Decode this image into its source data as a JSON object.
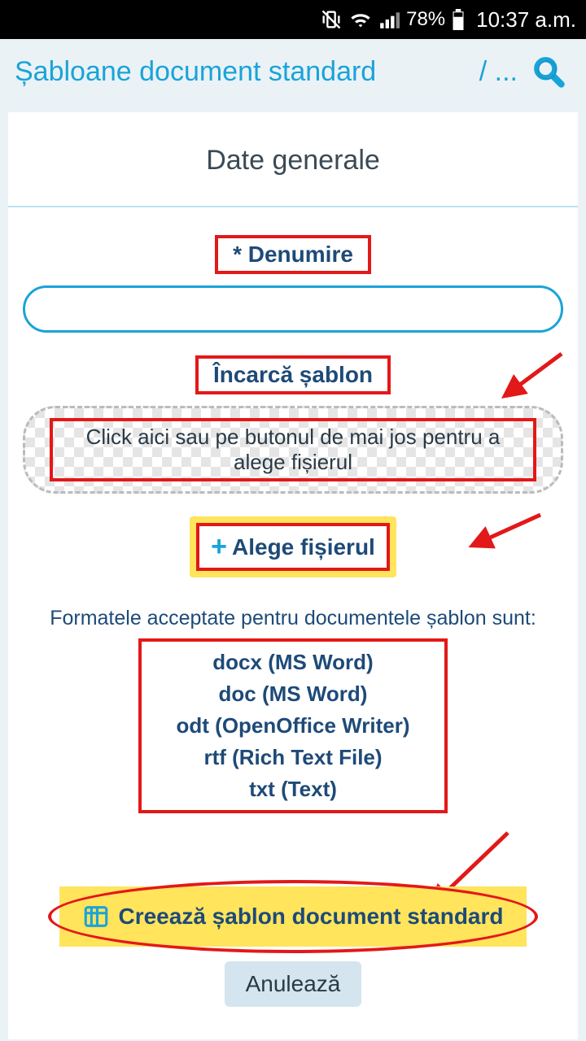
{
  "status": {
    "battery": "78%",
    "time": "10:37 a.m."
  },
  "header": {
    "title": "Șabloane document standard",
    "crumb": "/ ..."
  },
  "section_title": "Date generale",
  "name_field": {
    "label": "Denumire",
    "required_mark": "*"
  },
  "upload": {
    "label": "Încarcă șablon",
    "dropzone_text": "Click aici sau pe butonul de mai jos pentru a alege fișierul",
    "choose_label": "Alege fișierul"
  },
  "formats": {
    "intro": "Formatele acceptate pentru documentele șablon sunt:",
    "items": [
      "docx (MS Word)",
      "doc (MS Word)",
      "odt (OpenOffice Writer)",
      "rtf (Rich Text File)",
      "txt (Text)"
    ]
  },
  "actions": {
    "create": "Creează șablon document standard",
    "cancel": "Anulează"
  }
}
